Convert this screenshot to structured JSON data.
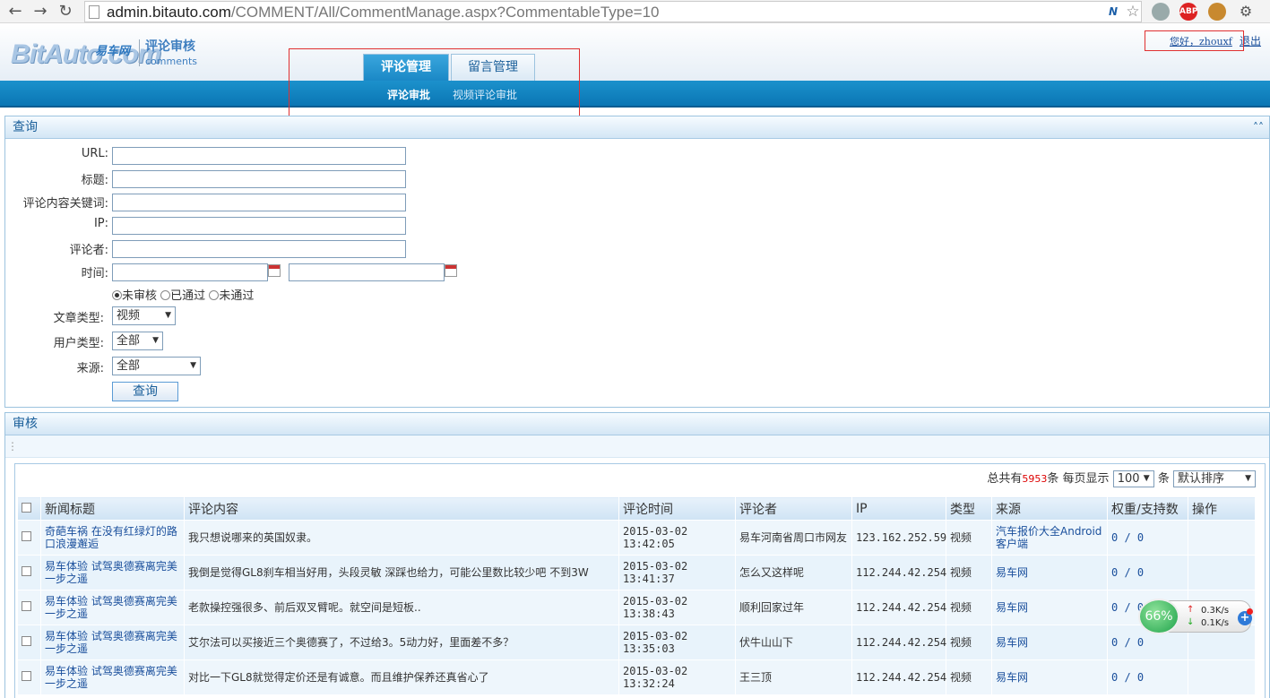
{
  "browser": {
    "url_host": "admin.bitauto.com",
    "url_path": "/COMMENT/All/CommentManage.aspx?CommentableType=10",
    "ext_abp": "ABP"
  },
  "header": {
    "logo": "BitAuto.com",
    "logo_badge": "易车网",
    "logo_sub": "评论审核",
    "logo_sub2": "comments",
    "user_greeting": "您好，zhouxf",
    "logout": "退出"
  },
  "tabs": [
    {
      "label": "评论管理",
      "active": true
    },
    {
      "label": "留言管理",
      "active": false
    }
  ],
  "subnav": [
    {
      "label": "评论审批",
      "active": true
    },
    {
      "label": "视频评论审批",
      "active": false
    }
  ],
  "query": {
    "title": "查询",
    "collapse": "«",
    "labels": {
      "url": "URL:",
      "title": "标题:",
      "keyword": "评论内容关键词:",
      "ip": "IP:",
      "commenter": "评论者:",
      "time": "时间:",
      "article_type": "文章类型:",
      "user_type": "用户类型:",
      "source": "来源:"
    },
    "radios": [
      {
        "label": "未审核",
        "checked": true
      },
      {
        "label": "已通过",
        "checked": false
      },
      {
        "label": "未通过",
        "checked": false
      }
    ],
    "article_type_value": "视频",
    "user_type_value": "全部",
    "source_value": "全部",
    "button": "查询"
  },
  "review": {
    "title": "审核",
    "toolbar_handle": "⋮",
    "summary_prefix": "总共有",
    "total": "5953",
    "summary_suffix": "条 每页显示",
    "per_page": "100",
    "unit": "条",
    "sort": "默认排序",
    "columns": [
      "新闻标题",
      "评论内容",
      "评论时间",
      "评论者",
      "IP",
      "类型",
      "来源",
      "权重/支持数",
      "操作"
    ],
    "rows": [
      {
        "title": "奇葩车祸 在没有红绿灯的路口浪漫邂逅",
        "content": "我只想说哪来的英国奴隶。",
        "time": "2015-03-02 13:42:05",
        "user": "易车河南省周口市网友",
        "ip": "123.162.252.59",
        "type": "视频",
        "source": "汽车报价大全Android客户端",
        "weight": "0 / 0"
      },
      {
        "title": "易车体验 试驾奥德赛离完美一步之遥",
        "content": "我倒是觉得GL8刹车相当好用，头段灵敏 深踩也给力，可能公里数比较少吧 不到3W",
        "time": "2015-03-02 13:41:37",
        "user": "怎么又这样呢",
        "ip": "112.244.42.254",
        "type": "视频",
        "source": "易车网",
        "weight": "0 / 0"
      },
      {
        "title": "易车体验 试驾奥德赛离完美一步之遥",
        "content": "老款操控强很多、前后双叉臂呢。就空间是短板..",
        "time": "2015-03-02 13:38:43",
        "user": "顺利回家过年",
        "ip": "112.244.42.254",
        "type": "视频",
        "source": "易车网",
        "weight": "0 / 0"
      },
      {
        "title": "易车体验 试驾奥德赛离完美一步之遥",
        "content": "艾尔法可以买接近三个奥德赛了，不过给3。5动力好，里面差不多？",
        "time": "2015-03-02 13:35:03",
        "user": "伏牛山山下",
        "ip": "112.244.42.254",
        "type": "视频",
        "source": "易车网",
        "weight": "0 / 0"
      },
      {
        "title": "易车体验 试驾奥德赛离完美一步之遥",
        "content": "对比一下GL8就觉得定价还是有诚意。而且维护保养还真省心了",
        "time": "2015-03-02 13:32:24",
        "user": "王三顶",
        "ip": "112.244.42.254",
        "type": "视频",
        "source": "易车网",
        "weight": "0 / 0"
      }
    ]
  },
  "speed": {
    "percent": "66%",
    "up": "0.3K/s",
    "down": "0.1K/s",
    "up_arrow": "↑",
    "down_arrow": "↓",
    "plus": "+"
  }
}
